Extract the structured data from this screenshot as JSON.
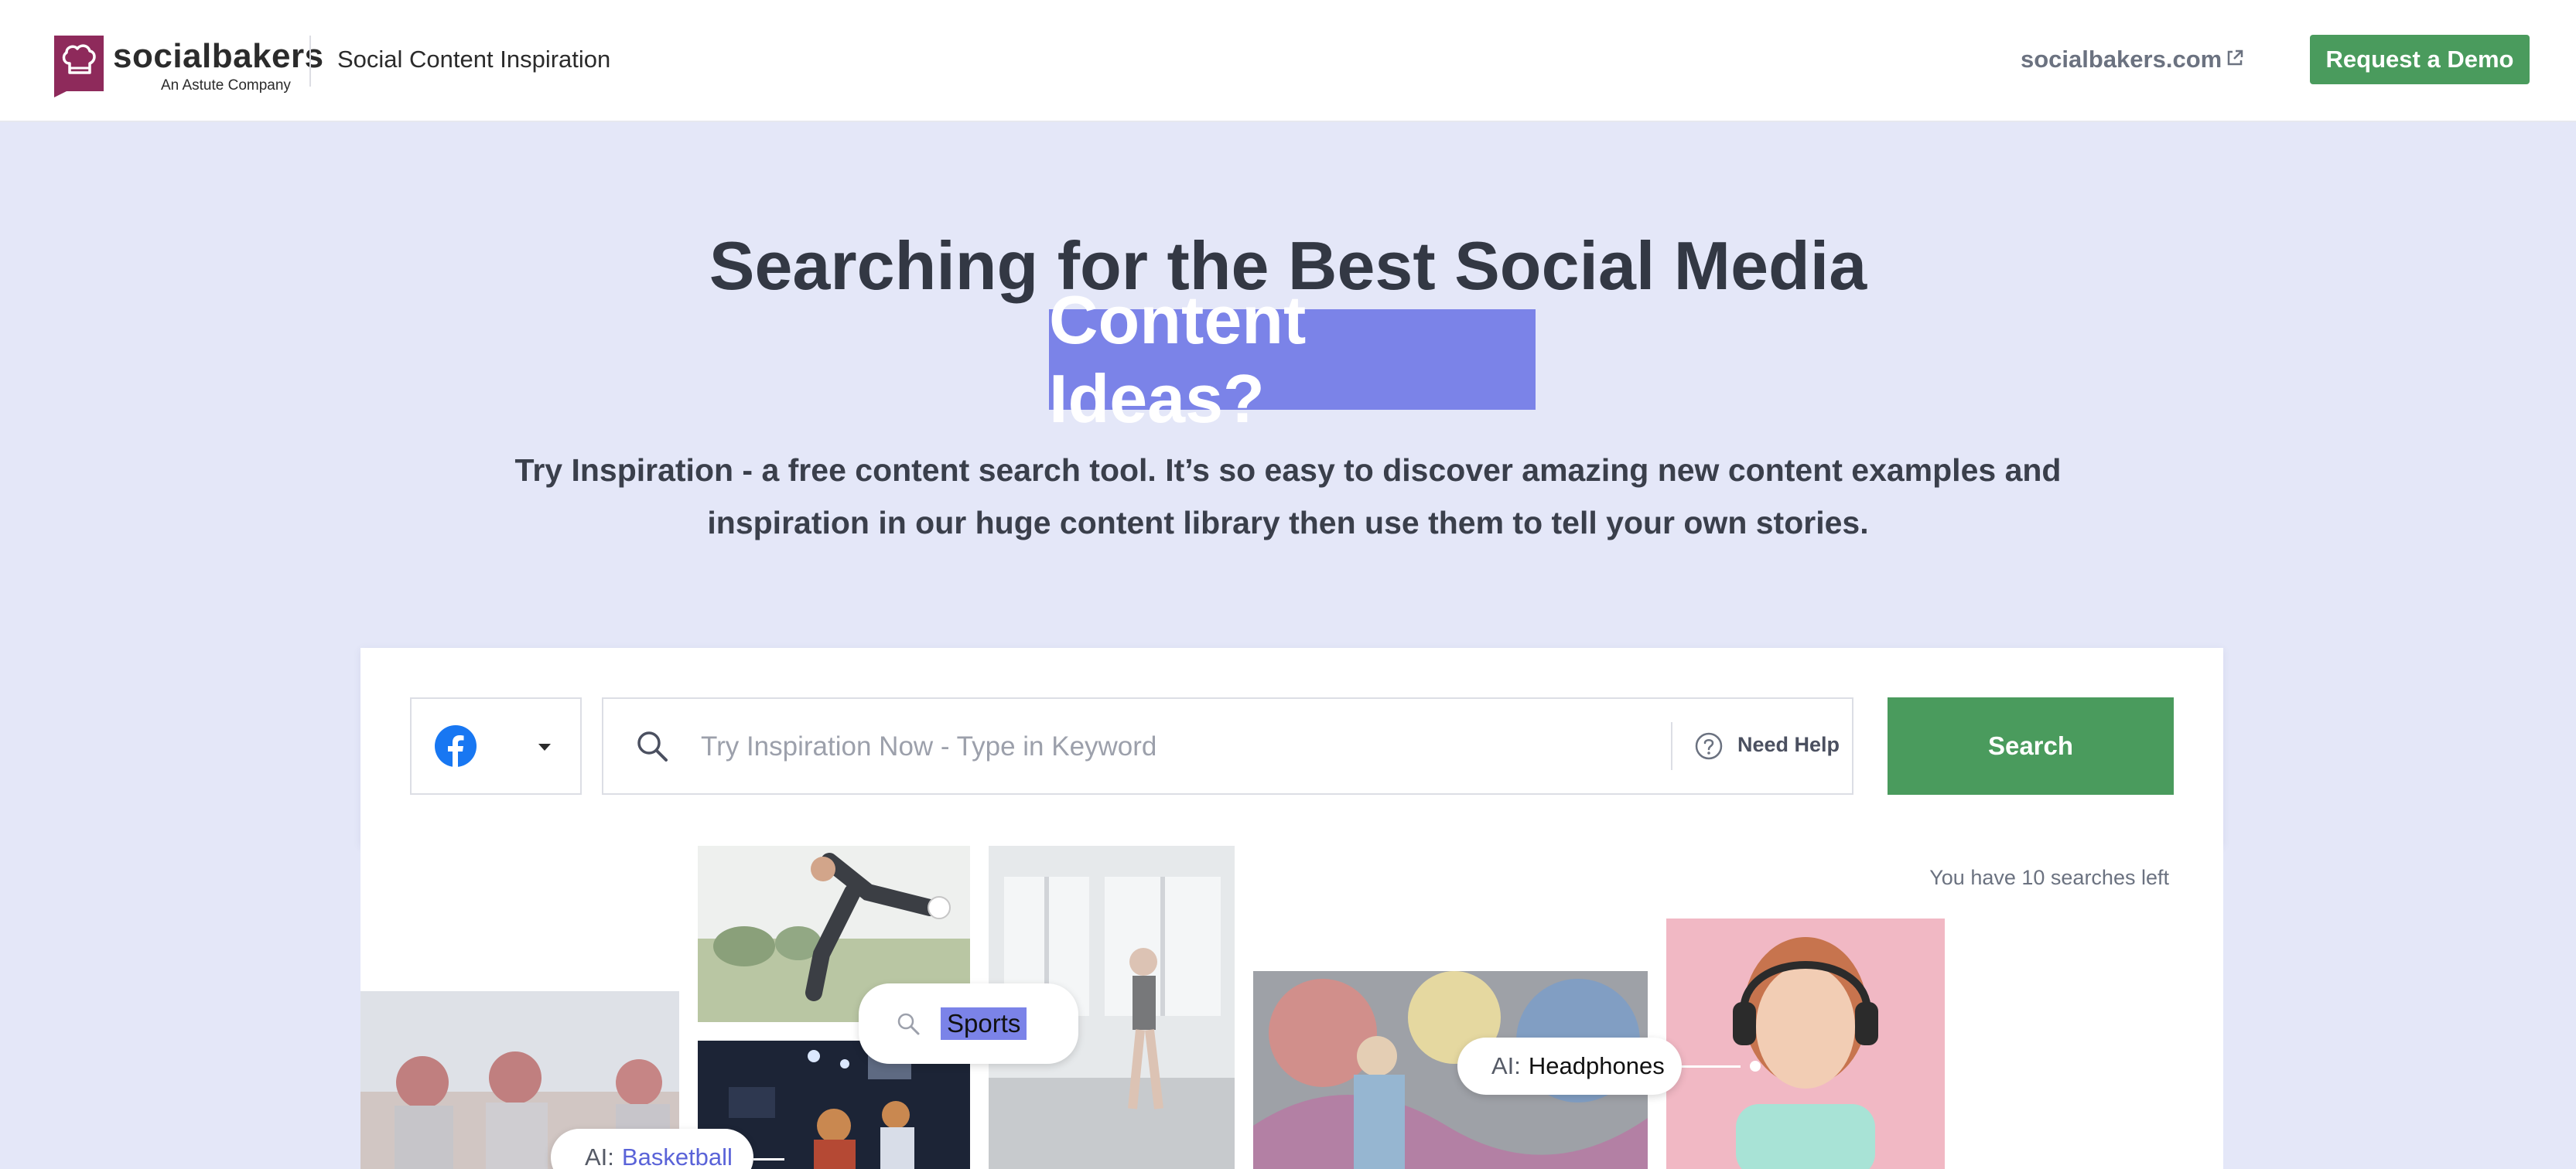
{
  "header": {
    "logo_text": "socialbakers",
    "logo_subtext": "An Astute Company",
    "app_title": "Social Content Inspiration",
    "external_link": "socialbakers.com",
    "demo_button": "Request a Demo"
  },
  "hero": {
    "title": "Searching for the Best Social Media",
    "highlight": "Content Ideas?",
    "description": "Try Inspiration - a free content search tool. It’s so easy to discover amazing new content examples and inspiration in our huge content library then use them to tell your own stories."
  },
  "search": {
    "network": "facebook-icon",
    "placeholder": "Try Inspiration Now - Type in Keyword",
    "value": "",
    "help_label": "Need Help",
    "button_label": "Search",
    "searches_left": "You have 10 searches left"
  },
  "gallery": {
    "sports_query": "Sports",
    "ai_prefix": "AI:",
    "ai_tags": {
      "headphones": "Headphones",
      "basketball": "Basketball"
    }
  },
  "colors": {
    "accent": "#7b83e8",
    "primary_button": "#4a9b5d",
    "background": "#e4e7f8",
    "logo": "#8e2a5b",
    "facebook": "#1877f2"
  }
}
